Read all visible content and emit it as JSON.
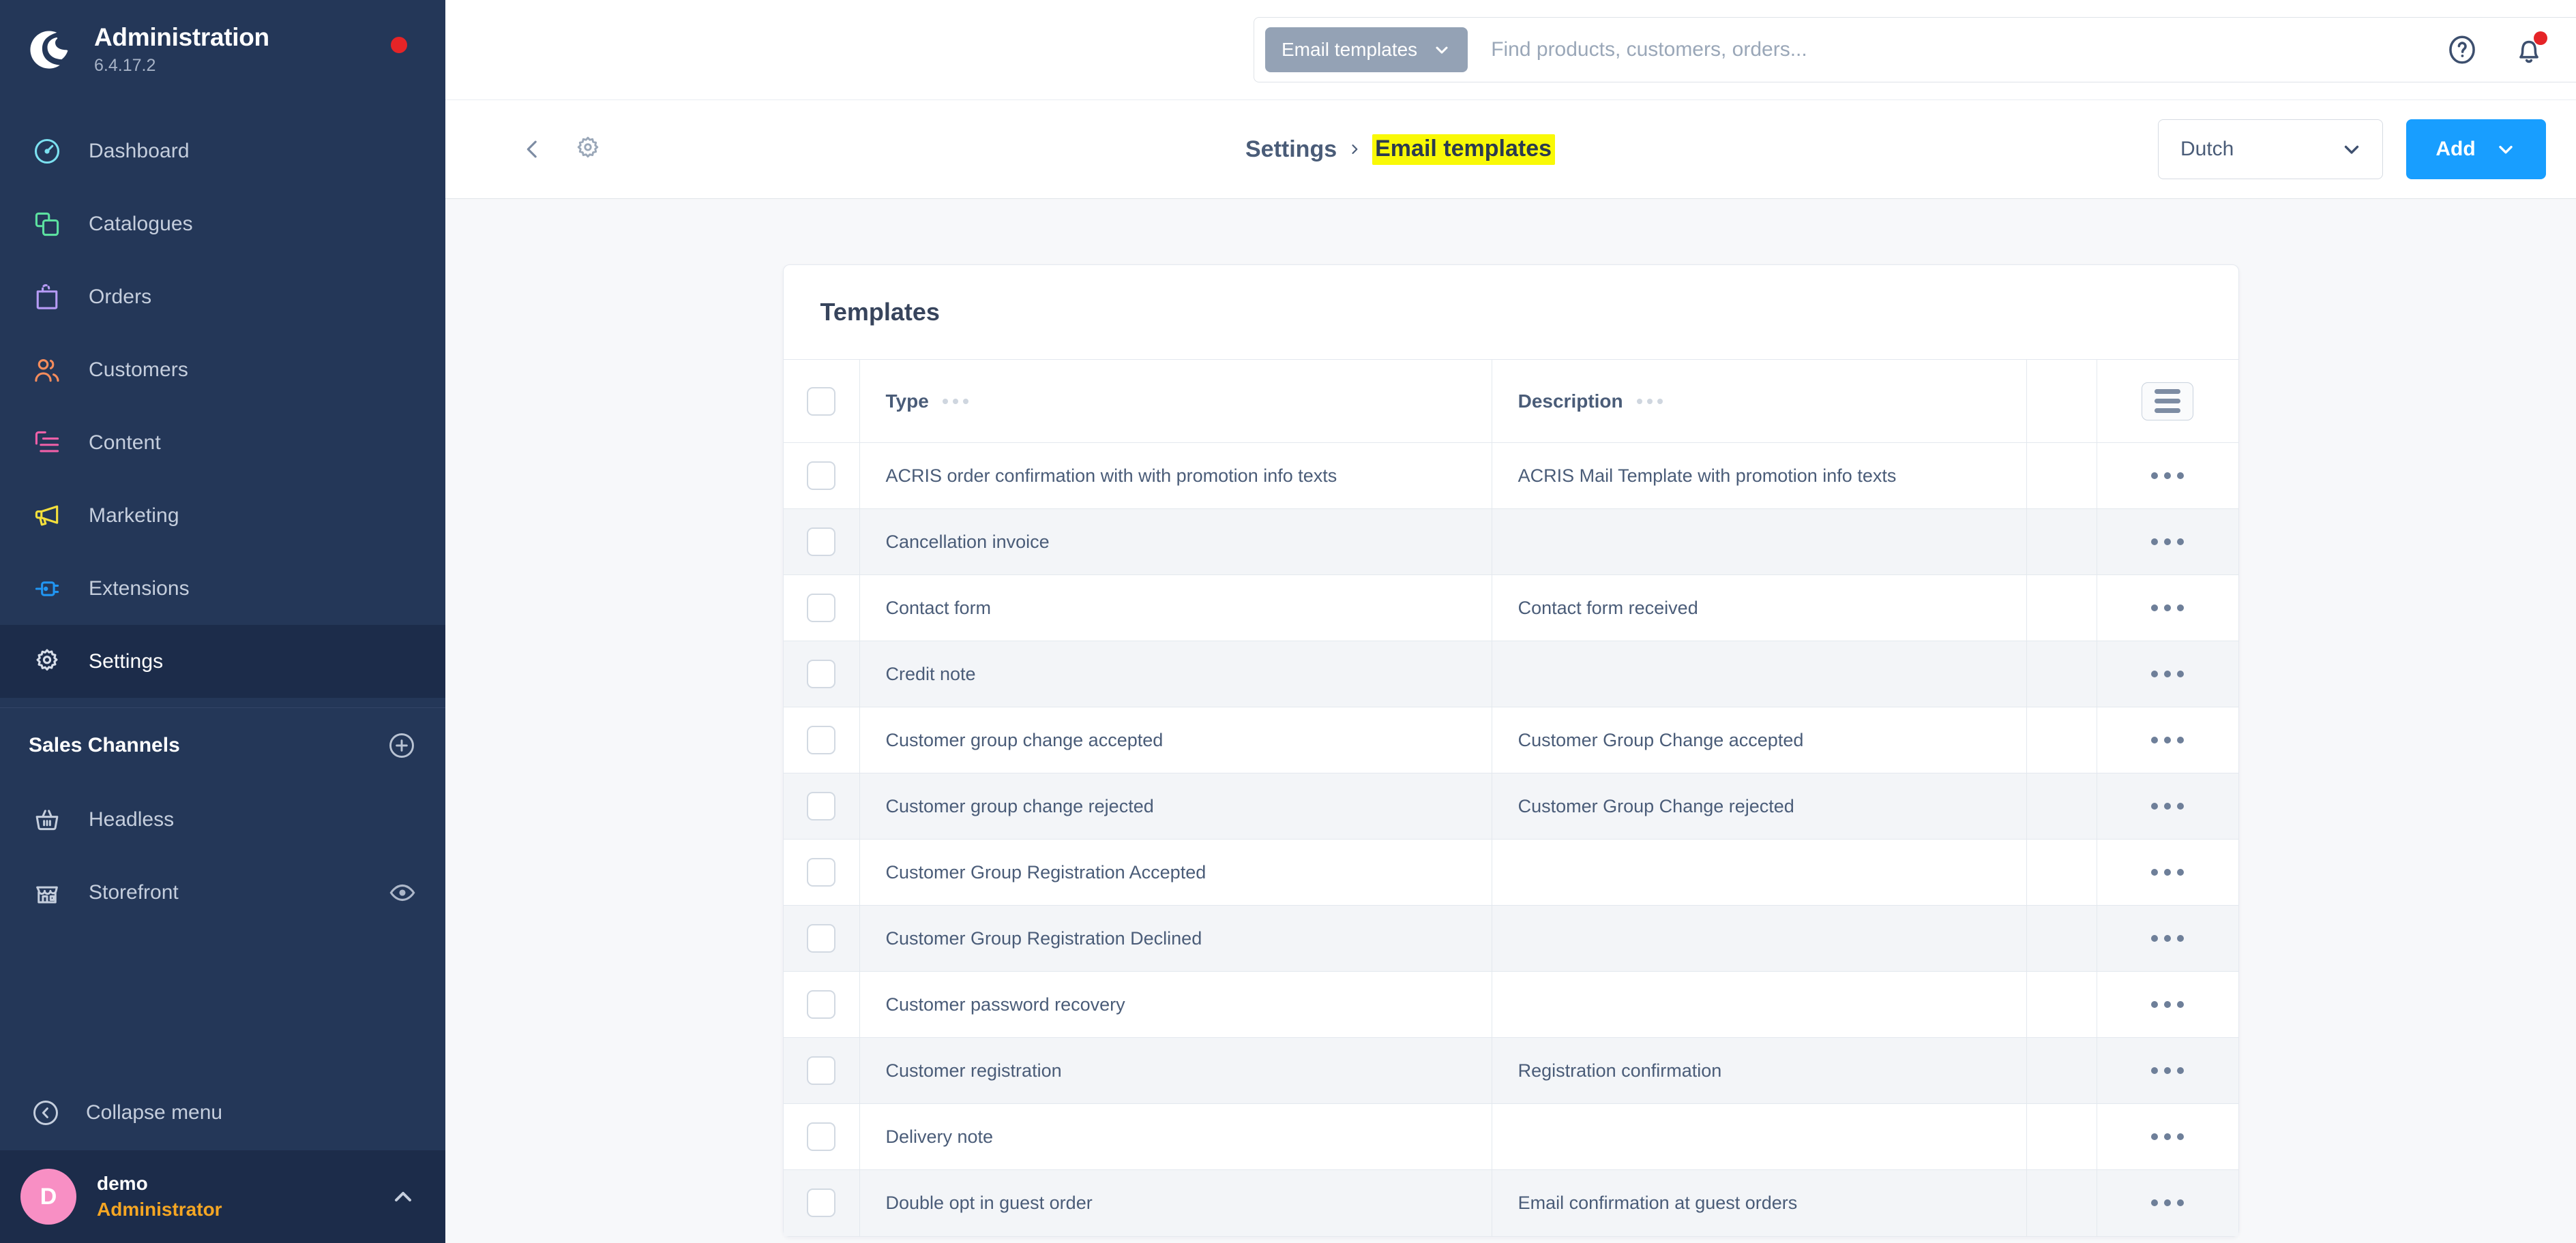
{
  "sidebar": {
    "brand": {
      "title": "Administration",
      "version": "6.4.17.2",
      "logo_icon": "shopware-logo-icon",
      "status_dot_color": "#e52427"
    },
    "items": [
      {
        "label": "Dashboard",
        "icon": "dashboard-icon",
        "color": "#7be0f0",
        "active": false
      },
      {
        "label": "Catalogues",
        "icon": "catalogues-icon",
        "color": "#5ce0a0",
        "active": false
      },
      {
        "label": "Orders",
        "icon": "orders-icon",
        "color": "#b69bf5",
        "active": false
      },
      {
        "label": "Customers",
        "icon": "customers-icon",
        "color": "#f58c5c",
        "active": false
      },
      {
        "label": "Content",
        "icon": "content-icon",
        "color": "#f060a8",
        "active": false
      },
      {
        "label": "Marketing",
        "icon": "marketing-icon",
        "color": "#f5e03c",
        "active": false
      },
      {
        "label": "Extensions",
        "icon": "extensions-icon",
        "color": "#2196f3",
        "active": false
      },
      {
        "label": "Settings",
        "icon": "gear-icon",
        "color": "#c5cedd",
        "active": true
      }
    ],
    "sales_channels": {
      "heading": "Sales Channels",
      "add_icon": "plus-circle-icon",
      "items": [
        {
          "label": "Headless",
          "icon": "basket-icon",
          "trailing_icon": ""
        },
        {
          "label": "Storefront",
          "icon": "store-icon",
          "trailing_icon": "eye-icon"
        }
      ]
    },
    "collapse": {
      "label": "Collapse menu",
      "icon": "chevron-left-circle-icon"
    },
    "user": {
      "initial": "D",
      "name": "demo",
      "role": "Administrator",
      "chevron_icon": "chevron-up-icon",
      "avatar_color": "#f88fc4",
      "role_color": "#f5a623"
    }
  },
  "topbar": {
    "search": {
      "scope_chip": "Email templates",
      "scope_chevron_icon": "chevron-down-icon",
      "placeholder": "Find products, customers, orders...",
      "value": "",
      "search_icon": "search-icon"
    },
    "help_icon": "help-circle-icon",
    "notifications_icon": "bell-icon",
    "notifications_badge_color": "#e52427"
  },
  "smartbar": {
    "back_icon": "chevron-left-icon",
    "gear_icon": "gear-icon",
    "breadcrumb": {
      "parent": "Settings",
      "separator_icon": "chevron-right-icon",
      "current": "Email templates",
      "highlight_color": "#f9f906"
    },
    "language": {
      "value": "Dutch",
      "chevron_icon": "chevron-down-icon"
    },
    "add_button": {
      "label": "Add",
      "chevron_icon": "chevron-down-icon",
      "color": "#189eff"
    }
  },
  "card": {
    "title": "Templates",
    "columns": [
      {
        "key": "select",
        "label": "",
        "type": "checkbox"
      },
      {
        "key": "type",
        "label": "Type",
        "dots_icon": "column-menu-icon"
      },
      {
        "key": "description",
        "label": "Description",
        "dots_icon": "column-menu-icon"
      },
      {
        "key": "gap",
        "label": ""
      },
      {
        "key": "actions",
        "label": "",
        "icon": "list-settings-icon"
      }
    ],
    "rows": [
      {
        "type": "ACRIS order confirmation with with promotion info texts",
        "description": "ACRIS Mail Template with promotion info texts",
        "actions_icon": "context-menu-icon"
      },
      {
        "type": "Cancellation invoice",
        "description": "",
        "actions_icon": "context-menu-icon"
      },
      {
        "type": "Contact form",
        "description": "Contact form received",
        "actions_icon": "context-menu-icon"
      },
      {
        "type": "Credit note",
        "description": "",
        "actions_icon": "context-menu-icon"
      },
      {
        "type": "Customer group change accepted",
        "description": "Customer Group Change accepted",
        "actions_icon": "context-menu-icon"
      },
      {
        "type": "Customer group change rejected",
        "description": "Customer Group Change rejected",
        "actions_icon": "context-menu-icon"
      },
      {
        "type": "Customer Group Registration Accepted",
        "description": "",
        "actions_icon": "context-menu-icon"
      },
      {
        "type": "Customer Group Registration Declined",
        "description": "",
        "actions_icon": "context-menu-icon"
      },
      {
        "type": "Customer password recovery",
        "description": "",
        "actions_icon": "context-menu-icon"
      },
      {
        "type": "Customer registration",
        "description": "Registration confirmation",
        "actions_icon": "context-menu-icon"
      },
      {
        "type": "Delivery note",
        "description": "",
        "actions_icon": "context-menu-icon"
      },
      {
        "type": "Double opt in guest order",
        "description": "Email confirmation at guest orders",
        "actions_icon": "context-menu-icon"
      }
    ]
  }
}
